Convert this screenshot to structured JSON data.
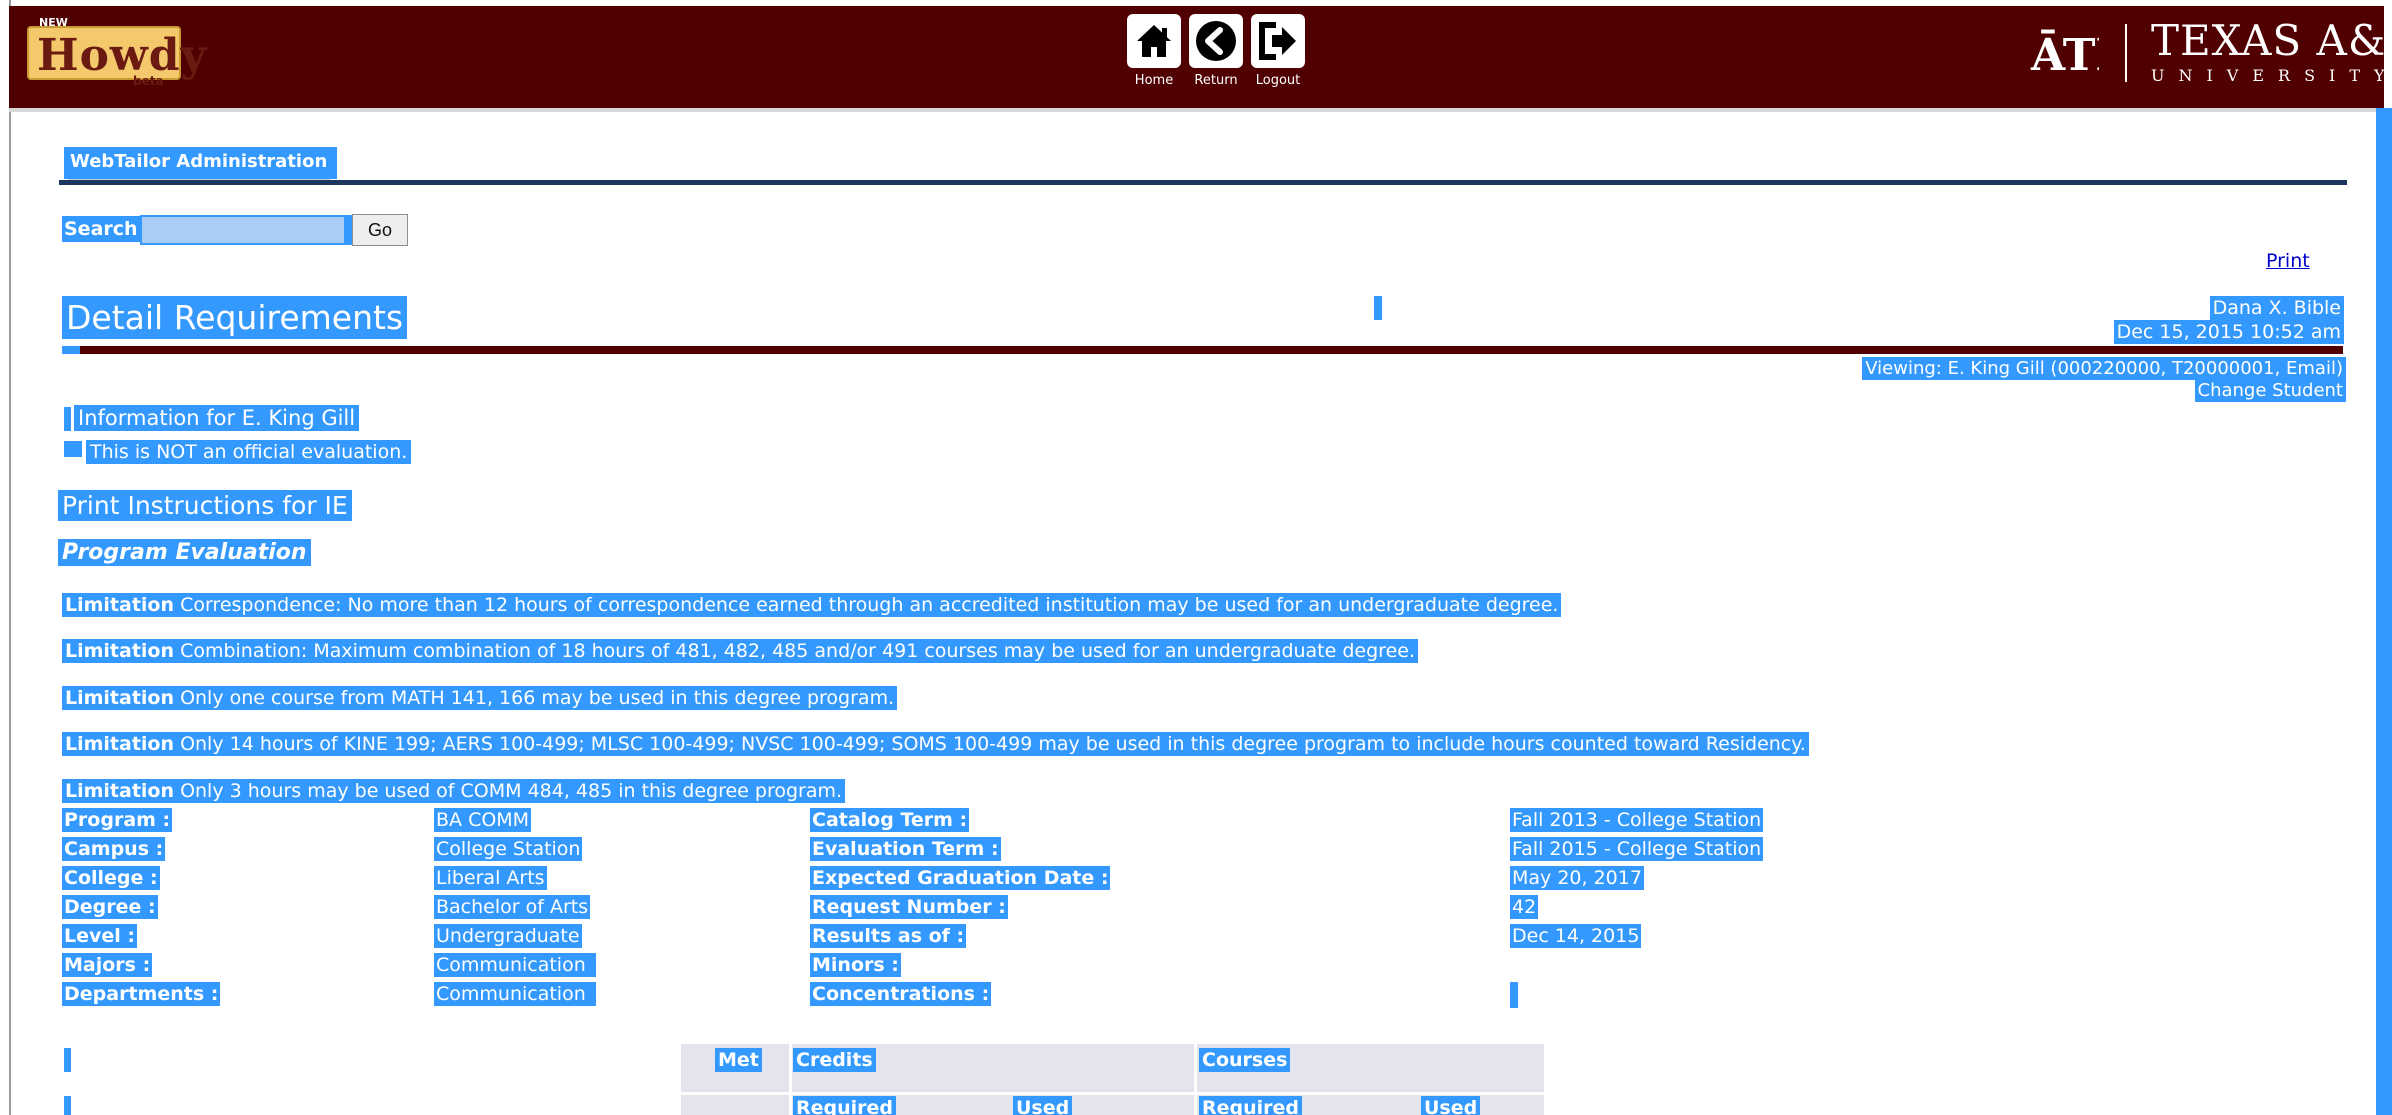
{
  "header": {
    "logo_new": "NEW",
    "logo_word": "Howdy",
    "logo_beta": "beta",
    "nav": [
      {
        "label": "Home",
        "icon": "home-icon"
      },
      {
        "label": "Return",
        "icon": "back-icon"
      },
      {
        "label": "Logout",
        "icon": "logout-icon"
      }
    ],
    "university_title": "TEXAS A&M",
    "university_sub": "UNIVERSITY",
    "brand_color": "#500000"
  },
  "tab": {
    "label": "WebTailor Administration"
  },
  "search": {
    "label": "Search",
    "value": "",
    "go_label": "Go"
  },
  "print_label": "Print",
  "page": {
    "title": "Detail Requirements",
    "user_name": "Dana X. Bible",
    "timestamp": "Dec 15, 2015 10:52 am",
    "viewing": "Viewing: E. King Gill (000220000, T20000001, Email)",
    "change_student": "Change Student",
    "info": "Information for E. King Gill",
    "note": "This is NOT an official evaluation.",
    "print_instructions": "Print Instructions for IE",
    "program_evaluation": "Program Evaluation"
  },
  "limitations": [
    {
      "label": "Limitation",
      "text": "Correspondence: No more than 12 hours of correspondence earned through an accredited institution may be used for an undergraduate degree."
    },
    {
      "label": "Limitation",
      "text": "Combination: Maximum combination of 18 hours of 481, 482, 485 and/or 491 courses may be used for an undergraduate degree."
    },
    {
      "label": "Limitation",
      "text": "Only one course from MATH 141, 166 may be used in this degree program."
    },
    {
      "label": "Limitation",
      "text": "Only 14 hours of KINE 199; AERS 100-499; MLSC 100-499; NVSC 100-499; SOMS 100-499 may be used in this degree program to include hours counted toward Residency."
    },
    {
      "label": "Limitation",
      "text": "Only 3 hours may be used of COMM 484, 485 in this degree program."
    }
  ],
  "program_info": [
    {
      "label": "Program :",
      "value": "BA COMM",
      "label2": "Catalog Term :",
      "value2": "Fall 2013 - College Station"
    },
    {
      "label": "Campus :",
      "value": "College Station",
      "label2": "Evaluation Term :",
      "value2": "Fall 2015 - College Station"
    },
    {
      "label": "College :",
      "value": "Liberal Arts",
      "label2": "Expected Graduation Date :",
      "value2": "May 20, 2017"
    },
    {
      "label": "Degree :",
      "value": "Bachelor of Arts",
      "label2": "Request Number :",
      "value2": "42"
    },
    {
      "label": "Level :",
      "value": "Undergraduate",
      "label2": "Results as of :",
      "value2": "Dec 14, 2015"
    },
    {
      "label": "Majors :",
      "value": "Communication",
      "label2": "Minors :",
      "value2": ""
    },
    {
      "label": "Departments :",
      "value": "Communication",
      "label2": "Concentrations :",
      "value2": ""
    }
  ],
  "summary": {
    "met": "Met",
    "credits": "Credits",
    "courses": "Courses",
    "required": "Required",
    "used": "Used"
  }
}
